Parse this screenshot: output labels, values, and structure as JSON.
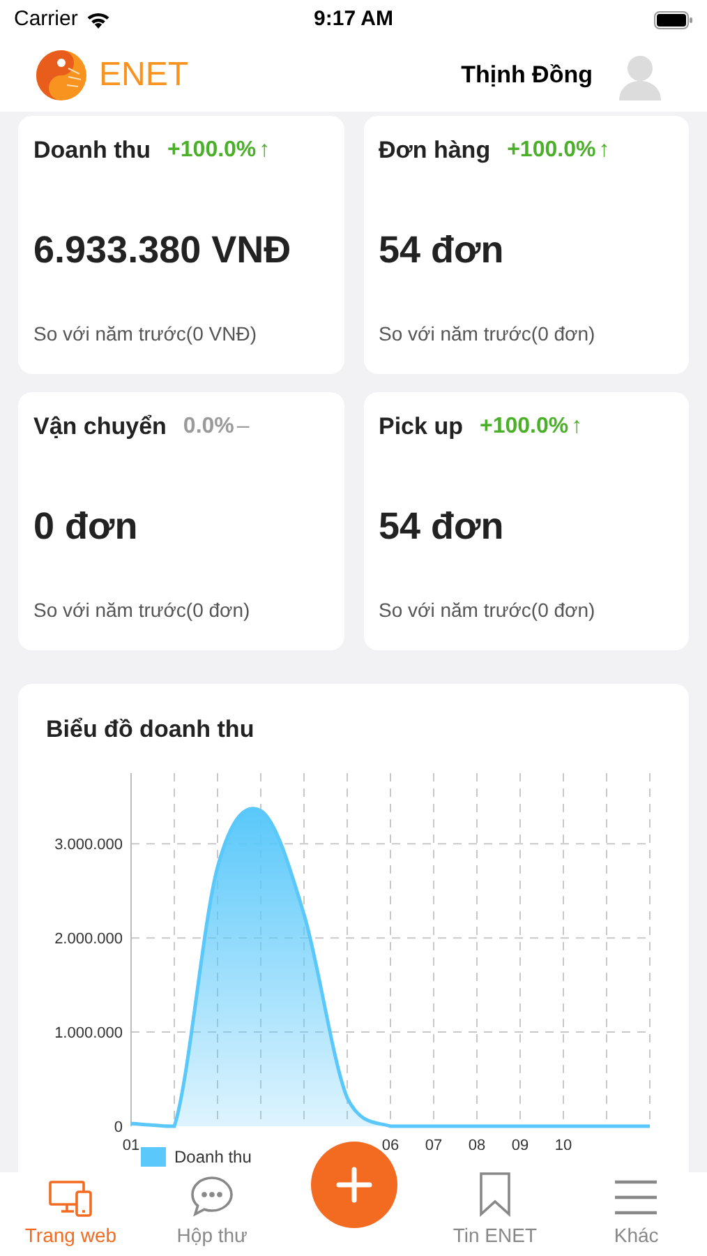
{
  "status_bar": {
    "carrier": "Carrier",
    "time": "9:17 AM"
  },
  "header": {
    "brand": "ENET",
    "user_name": "Thịnh Đồng"
  },
  "stats": [
    {
      "title": "Doanh thu",
      "change": "+100.0%",
      "kind": "up",
      "arrow": "↑",
      "value": "6.933.380 VNĐ",
      "comparison": "So với năm trước(0 VNĐ)"
    },
    {
      "title": "Đơn hàng",
      "change": "+100.0%",
      "kind": "up",
      "arrow": "↑",
      "value": "54 đơn",
      "comparison": "So với năm trước(0 đơn)"
    },
    {
      "title": "Vận chuyển",
      "change": "0.0%",
      "kind": "flat",
      "arrow": "–",
      "value": "0 đơn",
      "comparison": "So với năm trước(0 đơn)"
    },
    {
      "title": "Pick up",
      "change": "+100.0%",
      "kind": "up",
      "arrow": "↑",
      "value": "54 đơn",
      "comparison": "So với năm trước(0 đơn)"
    }
  ],
  "revenue_chart": {
    "chart_data": {
      "type": "area",
      "title": "Biểu đồ doanh thu",
      "categories": [
        "01",
        null,
        null,
        null,
        null,
        null,
        "06",
        "07",
        "08",
        "09",
        "10",
        null,
        null
      ],
      "grid": true,
      "series": [
        {
          "name": "Doanh thu",
          "color": "#5ac8fa",
          "values": [
            30000,
            0,
            2750000,
            3350000,
            2250000,
            300000,
            0,
            0,
            0,
            0,
            0,
            0,
            0
          ]
        }
      ],
      "ylim": [
        0,
        3750000
      ],
      "yticks": [
        {
          "value": 0,
          "label": "0"
        },
        {
          "value": 1000000,
          "label": "1.000.000"
        },
        {
          "value": 2000000,
          "label": "2.000.000"
        },
        {
          "value": 3000000,
          "label": "3.000.000"
        }
      ]
    }
  },
  "tab_bar": [
    {
      "label": "Trang web",
      "kind": "tab",
      "selected": true
    },
    {
      "label": "Hộp thư",
      "kind": "tab",
      "selected": false
    },
    {
      "kind": "action",
      "selected": false
    },
    {
      "label": "Tin ENET",
      "kind": "tab",
      "selected": false
    },
    {
      "label": "Khác",
      "kind": "tab",
      "selected": false
    }
  ]
}
